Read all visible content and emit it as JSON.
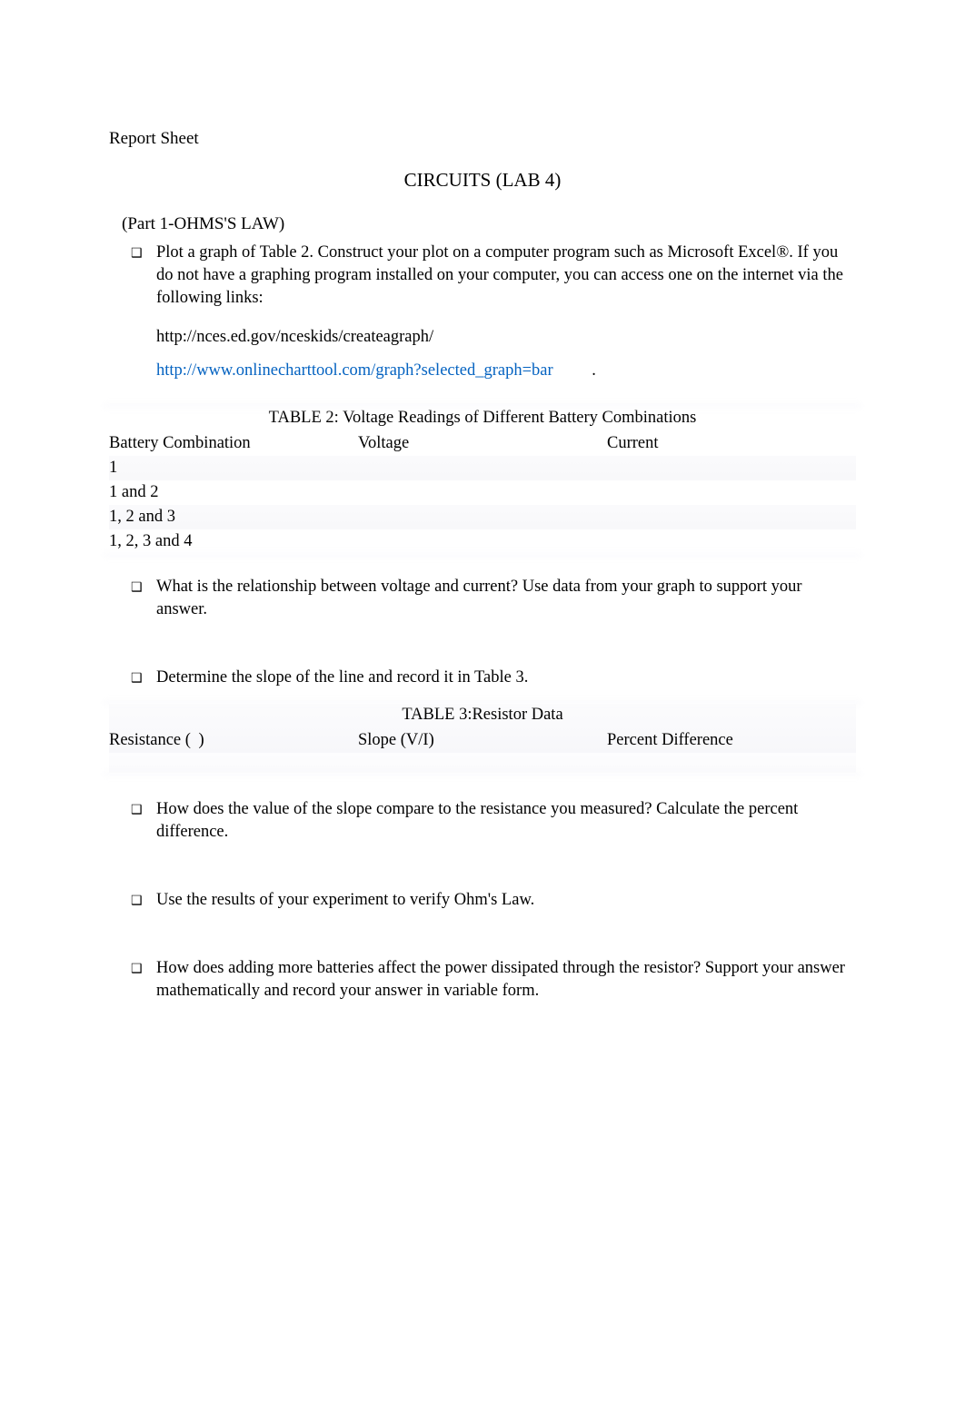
{
  "heading": "Report Sheet",
  "labTitle": "CIRCUITS (LAB 4)",
  "partTitle": "(Part 1-OHMS'S LAW)",
  "bullets": {
    "b1": "Plot a graph of Table 2. Construct your plot on a computer program such as Microsoft Excel®. If you do not have a graphing program installed on your computer, you can access one on the internet via the following links:",
    "url1": "http://nces.ed.gov/nceskids/createagraph/",
    "url2": "http://www.onlinecharttool.com/graph?selected_graph=bar",
    "dot": "."
  },
  "table2": {
    "title": "TABLE 2: Voltage Readings of Different Battery Combinations",
    "headers": {
      "c1": "Battery Combination",
      "c2": "Voltage",
      "c3": "Current"
    },
    "rows": [
      {
        "c1": "1",
        "c2": "",
        "c3": ""
      },
      {
        "c1": "1 and 2",
        "c2": "",
        "c3": ""
      },
      {
        "c1": "1, 2 and 3",
        "c2": "",
        "c3": ""
      },
      {
        "c1": "1, 2, 3 and 4",
        "c2": "",
        "c3": ""
      }
    ]
  },
  "questions": {
    "q1": "What is the relationship between voltage and current? Use data from your graph to support your answer.",
    "q2": "Determine the slope of the line and record it in Table 3.",
    "q3": "How does the value of the slope compare to the resistance you measured? Calculate the percent difference.",
    "q4": "Use the results of your experiment to verify Ohm's Law.",
    "q5": "How does adding more batteries affect the power dissipated through the resistor? Support your answer mathematically and record your answer in variable form."
  },
  "table3": {
    "title": "TABLE 3:Resistor Data",
    "headers": {
      "c1_pre": "Resistance ( ",
      "c1_glyph": "",
      "c1_post": " )",
      "c2": "Slope (V/I)",
      "c3": "Percent Difference"
    }
  }
}
